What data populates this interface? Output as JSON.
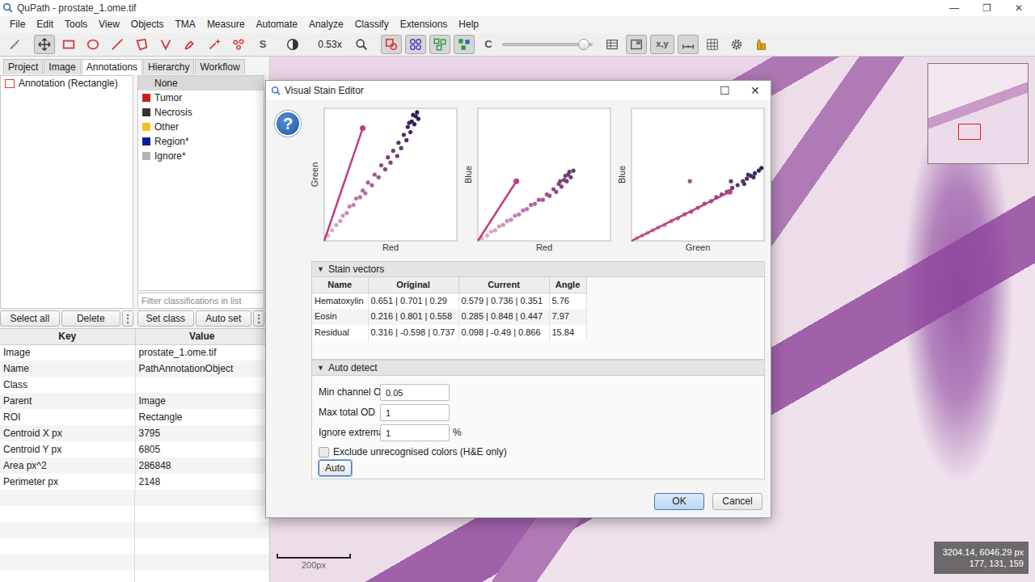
{
  "window": {
    "title": "QuPath - prostate_1.ome.tif",
    "controls": [
      "—",
      "❐",
      "✕"
    ]
  },
  "menu": [
    "File",
    "Edit",
    "Tools",
    "View",
    "Objects",
    "TMA",
    "Measure",
    "Automate",
    "Analyze",
    "Classify",
    "Extensions",
    "Help"
  ],
  "toolbar": {
    "items": [
      {
        "kind": "icon",
        "selected": false
      },
      {
        "kind": "icon",
        "selected": true
      },
      {
        "kind": "icon",
        "selected": false
      },
      {
        "kind": "icon",
        "selected": false
      },
      {
        "kind": "icon",
        "selected": false
      },
      {
        "kind": "icon",
        "selected": false
      },
      {
        "kind": "icon",
        "selected": false
      },
      {
        "kind": "icon",
        "selected": false
      },
      {
        "kind": "icon",
        "selected": false
      },
      {
        "kind": "icon",
        "selected": false
      },
      {
        "kind": "text",
        "label": "S",
        "selected": false
      },
      {
        "kind": "icon",
        "selected": false
      },
      {
        "kind": "zoom",
        "label": "0.53x"
      },
      {
        "kind": "icon",
        "selected": false
      },
      {
        "kind": "icon",
        "selected": true
      },
      {
        "kind": "icon",
        "selected": true
      },
      {
        "kind": "icon",
        "selected": true
      },
      {
        "kind": "icon",
        "selected": true
      },
      {
        "kind": "text",
        "label": "C",
        "selected": false
      },
      {
        "kind": "slider",
        "level": 0.97
      },
      {
        "kind": "icon",
        "selected": false
      },
      {
        "kind": "icon",
        "selected": true
      },
      {
        "kind": "text",
        "label": "x,y",
        "selected": true
      },
      {
        "kind": "icon",
        "selected": true
      },
      {
        "kind": "icon",
        "selected": false
      },
      {
        "kind": "icon",
        "selected": false
      },
      {
        "kind": "icon",
        "selected": false
      }
    ]
  },
  "left_tabs": [
    {
      "label": "Project",
      "selected": false
    },
    {
      "label": "Image",
      "selected": false
    },
    {
      "label": "Annotations",
      "selected": true
    },
    {
      "label": "Hierarchy",
      "selected": false
    },
    {
      "label": "Workflow",
      "selected": false
    }
  ],
  "annotations": [
    {
      "label": "Annotation (Rectangle)",
      "color": "#e03c3c",
      "selected": false
    }
  ],
  "classes": [
    {
      "label": "None",
      "selected": true
    },
    {
      "label": "Tumor",
      "color": "#c81e1e",
      "selected": false
    },
    {
      "label": "Necrosis",
      "color": "#333333",
      "selected": false
    },
    {
      "label": "Other",
      "color": "#f0c419",
      "selected": false
    },
    {
      "label": "Region*",
      "color": "#0a1e96",
      "selected": false
    },
    {
      "label": "Ignore*",
      "color": "#b4b4b4",
      "selected": false
    }
  ],
  "class_filter": {
    "placeholder": "Filter classifications in list"
  },
  "list_buttons": [
    "Select all",
    "Delete",
    "⋮",
    "Set class",
    "Auto set",
    "⋮"
  ],
  "properties": {
    "columns": [
      "Key",
      "Value"
    ],
    "rows": [
      [
        "Image",
        "prostate_1.ome.tif"
      ],
      [
        "Name",
        "PathAnnotationObject"
      ],
      [
        "Class",
        ""
      ],
      [
        "Parent",
        "Image"
      ],
      [
        "ROI",
        "Rectangle"
      ],
      [
        "Centroid X px",
        "3795"
      ],
      [
        "Centroid Y px",
        "6805"
      ],
      [
        "Area px^2",
        "286848"
      ],
      [
        "Perimeter px",
        "2148"
      ]
    ]
  },
  "viewer": {
    "scalebar": "200px",
    "coordinates": [
      "3204.14, 6046.29 px",
      "177, 131, 159"
    ]
  },
  "dialog": {
    "title": "Visual Stain Editor",
    "controls": [
      "☐",
      "✕"
    ],
    "help": "?",
    "plots": [
      {
        "x_label": "Red",
        "y_label": "Green",
        "stain": [
          0.29,
          0.85
        ],
        "points": [
          [
            0.03,
            0.04
          ],
          [
            0.06,
            0.08
          ],
          [
            0.09,
            0.12
          ],
          [
            0.12,
            0.15
          ],
          [
            0.14,
            0.19
          ],
          [
            0.17,
            0.21
          ],
          [
            0.19,
            0.26
          ],
          [
            0.22,
            0.27
          ],
          [
            0.24,
            0.32
          ],
          [
            0.27,
            0.33
          ],
          [
            0.29,
            0.38
          ],
          [
            0.31,
            0.36
          ],
          [
            0.33,
            0.44
          ],
          [
            0.36,
            0.42
          ],
          [
            0.38,
            0.5
          ],
          [
            0.41,
            0.48
          ],
          [
            0.43,
            0.57
          ],
          [
            0.46,
            0.54
          ],
          [
            0.48,
            0.63
          ],
          [
            0.5,
            0.59
          ],
          [
            0.52,
            0.68
          ],
          [
            0.55,
            0.64
          ],
          [
            0.56,
            0.74
          ],
          [
            0.58,
            0.7
          ],
          [
            0.6,
            0.8
          ],
          [
            0.62,
            0.76
          ],
          [
            0.63,
            0.86
          ],
          [
            0.65,
            0.82
          ],
          [
            0.66,
            0.9
          ],
          [
            0.68,
            0.88
          ],
          [
            0.69,
            0.94
          ],
          [
            0.7,
            0.97
          ],
          [
            0.71,
            0.92
          ],
          [
            0.67,
            0.95
          ],
          [
            0.64,
            0.89
          ]
        ]
      },
      {
        "x_label": "Red",
        "y_label": "Blue",
        "stain": [
          0.29,
          0.45
        ],
        "points": [
          [
            0.03,
            0.02
          ],
          [
            0.07,
            0.04
          ],
          [
            0.1,
            0.07
          ],
          [
            0.13,
            0.08
          ],
          [
            0.16,
            0.11
          ],
          [
            0.19,
            0.12
          ],
          [
            0.22,
            0.15
          ],
          [
            0.25,
            0.16
          ],
          [
            0.28,
            0.19
          ],
          [
            0.31,
            0.2
          ],
          [
            0.34,
            0.23
          ],
          [
            0.37,
            0.24
          ],
          [
            0.4,
            0.27
          ],
          [
            0.43,
            0.28
          ],
          [
            0.46,
            0.31
          ],
          [
            0.49,
            0.31
          ],
          [
            0.52,
            0.35
          ],
          [
            0.54,
            0.34
          ],
          [
            0.57,
            0.39
          ],
          [
            0.59,
            0.37
          ],
          [
            0.61,
            0.43
          ],
          [
            0.63,
            0.41
          ],
          [
            0.65,
            0.46
          ],
          [
            0.67,
            0.45
          ],
          [
            0.68,
            0.5
          ],
          [
            0.7,
            0.48
          ],
          [
            0.72,
            0.53
          ],
          [
            0.69,
            0.52
          ],
          [
            0.66,
            0.49
          ],
          [
            0.62,
            0.45
          ]
        ]
      },
      {
        "x_label": "Green",
        "y_label": "Blue",
        "stain": [
          0.74,
          0.37
        ],
        "points": [
          [
            0.04,
            0.02
          ],
          [
            0.08,
            0.04
          ],
          [
            0.12,
            0.06
          ],
          [
            0.16,
            0.08
          ],
          [
            0.2,
            0.1
          ],
          [
            0.25,
            0.12
          ],
          [
            0.3,
            0.15
          ],
          [
            0.35,
            0.17
          ],
          [
            0.4,
            0.2
          ],
          [
            0.45,
            0.22
          ],
          [
            0.5,
            0.25
          ],
          [
            0.55,
            0.28
          ],
          [
            0.6,
            0.3
          ],
          [
            0.64,
            0.33
          ],
          [
            0.68,
            0.35
          ],
          [
            0.72,
            0.37
          ],
          [
            0.76,
            0.4
          ],
          [
            0.8,
            0.42
          ],
          [
            0.84,
            0.45
          ],
          [
            0.87,
            0.47
          ],
          [
            0.9,
            0.49
          ],
          [
            0.93,
            0.51
          ],
          [
            0.96,
            0.53
          ],
          [
            0.98,
            0.55
          ],
          [
            0.44,
            0.45
          ],
          [
            0.75,
            0.45
          ],
          [
            0.88,
            0.5
          ],
          [
            0.92,
            0.48
          ],
          [
            0.85,
            0.43
          ]
        ]
      }
    ],
    "stain_vectors": {
      "title": "Stain vectors",
      "toggle": "▼",
      "expanded": true,
      "columns": [
        "Name",
        "Original",
        "Current",
        "Angle"
      ],
      "rows": [
        [
          "Hematoxylin",
          "0.651 | 0.701 | 0.29",
          "0.579 | 0.736 | 0.351",
          "5.76"
        ],
        [
          "Eosin",
          "0.216 | 0.801 | 0.558",
          "0.285 | 0.848 | 0.447",
          "7.97"
        ],
        [
          "Residual",
          "0.316 | -0.598 | 0.737",
          "0.098 | -0.49 | 0.866",
          "15.84"
        ]
      ]
    },
    "auto_detect": {
      "title": "Auto detect",
      "toggle": "▼",
      "expanded": true,
      "fields": [
        {
          "label": "Min channel OD",
          "value": "0.05"
        },
        {
          "label": "Max total OD",
          "value": "1"
        },
        {
          "label": "Ignore extrema",
          "value": "1",
          "unit": "%"
        }
      ],
      "checkbox": {
        "label": "Exclude unrecognised colors (H&E only)",
        "checked": false
      },
      "button": {
        "label": "Auto",
        "focused": true
      }
    },
    "buttons": [
      {
        "label": "OK",
        "default": true
      },
      {
        "label": "Cancel",
        "default": false
      }
    ]
  }
}
